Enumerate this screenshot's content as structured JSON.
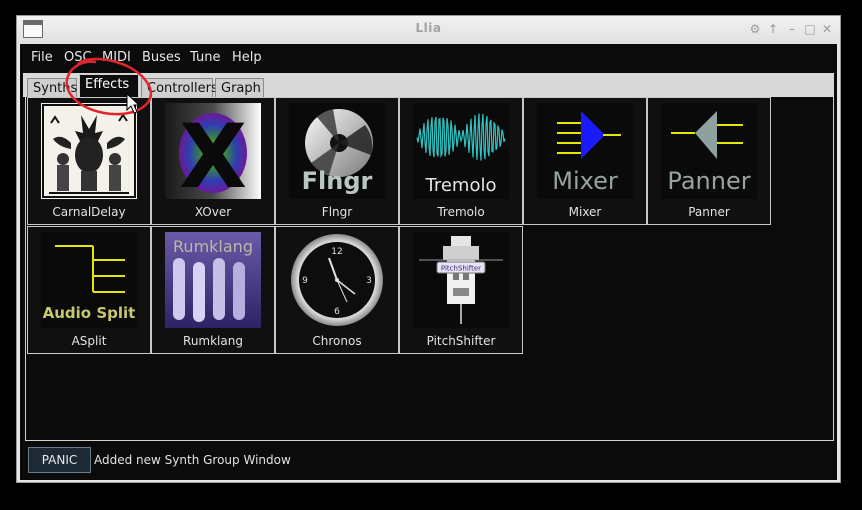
{
  "window": {
    "title": "Llia",
    "controls": [
      "⚙",
      "↑",
      "–",
      "□",
      "✕"
    ]
  },
  "menu": [
    "File",
    "OSC",
    "MIDI",
    "Buses",
    "Tune",
    "Help"
  ],
  "tabs": [
    {
      "label": "Synths",
      "active": false
    },
    {
      "label": "Effects",
      "active": true
    },
    {
      "label": "Controllers",
      "active": false
    },
    {
      "label": "Graph",
      "active": false
    }
  ],
  "effects": [
    {
      "label": "CarnalDelay",
      "icon": "carnaldelay-icon"
    },
    {
      "label": "XOver",
      "icon": "xover-icon",
      "art_text": "X"
    },
    {
      "label": "Flngr",
      "icon": "flngr-icon",
      "art_text": "Flngr"
    },
    {
      "label": "Tremolo",
      "icon": "tremolo-icon",
      "art_text": "Tremolo"
    },
    {
      "label": "Mixer",
      "icon": "mixer-icon",
      "art_text": "Mixer"
    },
    {
      "label": "Panner",
      "icon": "panner-icon",
      "art_text": "Panner"
    },
    {
      "label": "ASplit",
      "icon": "asplit-icon",
      "art_text": "Audio Split"
    },
    {
      "label": "Rumklang",
      "icon": "rumklang-icon",
      "art_text": "Rumklang"
    },
    {
      "label": "Chronos",
      "icon": "chronos-icon",
      "art_text": [
        "12",
        "3",
        "6",
        "9"
      ]
    },
    {
      "label": "PitchShifter",
      "icon": "pitchshifter-icon",
      "art_text": "PitchShifter"
    }
  ],
  "status": {
    "panic_label": "PANIC",
    "message": "Added new Synth Group Window"
  },
  "colors": {
    "accent_blue": "#1a1aff",
    "mixer_line": "#e6e600",
    "annotation_red": "#e0262c"
  }
}
